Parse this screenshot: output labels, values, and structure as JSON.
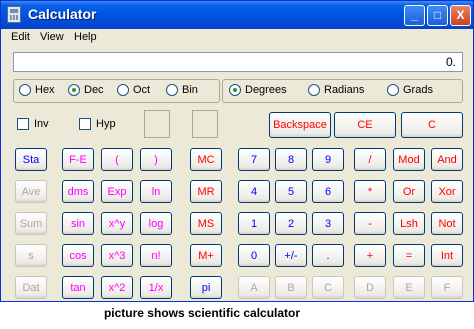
{
  "window": {
    "title": "Calculator"
  },
  "title_buttons": {
    "minimize": "_",
    "maximize": "□",
    "close": "X"
  },
  "menu": [
    "Edit",
    "View",
    "Help"
  ],
  "display": {
    "value": "0."
  },
  "number_system": [
    {
      "label": "Hex",
      "checked": false
    },
    {
      "label": "Dec",
      "checked": true
    },
    {
      "label": "Oct",
      "checked": false
    },
    {
      "label": "Bin",
      "checked": false
    }
  ],
  "angle_unit": [
    {
      "label": "Degrees",
      "checked": true
    },
    {
      "label": "Radians",
      "checked": false
    },
    {
      "label": "Grads",
      "checked": false
    }
  ],
  "options": [
    {
      "label": "Inv",
      "checked": false
    },
    {
      "label": "Hyp",
      "checked": false
    }
  ],
  "top_buttons": [
    "Backspace",
    "CE",
    "C"
  ],
  "stat_buttons": [
    "Sta",
    "Ave",
    "Sum",
    "s",
    "Dat"
  ],
  "sci_col1": [
    "F-E",
    "sin",
    "cos",
    "tan",
    "dms",
    "Exp",
    "x^y",
    "x^3",
    "x^2",
    "ln",
    "log",
    "n!",
    "1/x",
    "(",
    ")"
  ],
  "memory_buttons": [
    "MC",
    "MR",
    "MS",
    "M+",
    "pi"
  ],
  "keypad": [
    [
      "7",
      "8",
      "9",
      "/",
      "Mod",
      "And"
    ],
    [
      "4",
      "5",
      "6",
      "*",
      "Or",
      "Xor"
    ],
    [
      "1",
      "2",
      "3",
      "-",
      "Lsh",
      "Not"
    ],
    [
      "0",
      "+/-",
      ".",
      "+",
      "=",
      "Int"
    ],
    [
      "A",
      "B",
      "C",
      "D",
      "E",
      "F"
    ]
  ],
  "caption": "picture shows scientific calculator"
}
